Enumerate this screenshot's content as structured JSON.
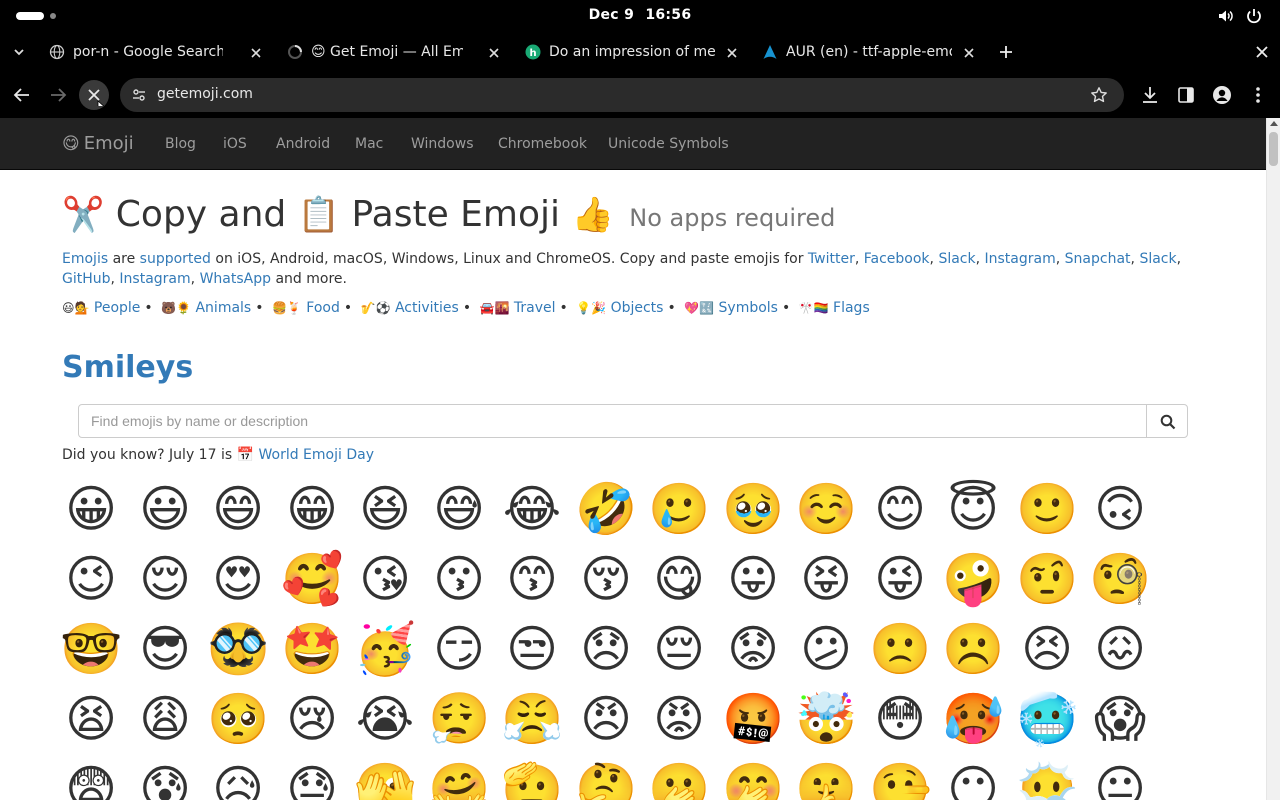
{
  "os": {
    "date": "Dec 9",
    "time": "16:56"
  },
  "tabs": [
    {
      "title": "por-n - Google Search",
      "favicon": "globe-icon"
    },
    {
      "title": "😊 Get Emoji — All Emoj",
      "favicon": "loading-spinner-icon"
    },
    {
      "title": "Do an impression of me",
      "favicon": "chatbot-icon"
    },
    {
      "title": "AUR (en) - ttf-apple-emo",
      "favicon": "arch-linux-icon"
    }
  ],
  "toolbar": {
    "url": "getemoji.com"
  },
  "site": {
    "brand_emoji": "😋",
    "brand": "Emoji",
    "nav": [
      "Blog",
      "iOS",
      "Android",
      "Mac",
      "Windows",
      "Chromebook",
      "Unicode Symbols"
    ],
    "headline": {
      "emoji1": "✂️",
      "text1": "Copy and",
      "emoji2": "📋",
      "text2": "Paste Emoji",
      "emoji3": "👍",
      "sub": "No apps required"
    },
    "intro": {
      "emojis": "Emojis",
      "are": "are",
      "supported": "supported",
      "text1": "on iOS, Android, macOS, Windows, Linux and ChromeOS. Copy and paste emojis for",
      "platforms": [
        "Twitter",
        "Facebook",
        "Slack",
        "Instagram",
        "Snapchat",
        "Slack",
        "GitHub",
        "Instagram",
        "WhatsApp"
      ],
      "text2": "and more."
    },
    "categories": [
      {
        "emojis": "😃💁",
        "label": "People"
      },
      {
        "emojis": "🐻🌻",
        "label": "Animals"
      },
      {
        "emojis": "🍔🍹",
        "label": "Food"
      },
      {
        "emojis": "🎷⚽️",
        "label": "Activities"
      },
      {
        "emojis": "🚘🌇",
        "label": "Travel"
      },
      {
        "emojis": "💡🎉",
        "label": "Objects"
      },
      {
        "emojis": "💖🔣",
        "label": "Symbols"
      },
      {
        "emojis": "🎌🏳️‍🌈",
        "label": "Flags"
      }
    ],
    "section_title": "Smileys",
    "search": {
      "placeholder": "Find emojis by name or description"
    },
    "did_you_know": {
      "text": "Did you know? July 17 is",
      "emoji": "📅",
      "link": "World Emoji Day"
    },
    "emoji_rows": [
      [
        "😀",
        "😃",
        "😄",
        "😁",
        "😆",
        "😅",
        "😂",
        "🤣",
        "🥲",
        "🥹",
        "☺️",
        "😊",
        "😇",
        "🙂",
        "🙃"
      ],
      [
        "😉",
        "😌",
        "😍",
        "🥰",
        "😘",
        "😗",
        "😙",
        "😚",
        "😋",
        "😛",
        "😝",
        "😜",
        "🤪",
        "🤨",
        "🧐"
      ],
      [
        "🤓",
        "😎",
        "🥸",
        "🤩",
        "🥳",
        "😏",
        "😒",
        "😞",
        "😔",
        "😟",
        "😕",
        "🙁",
        "☹️",
        "😣",
        "😖"
      ],
      [
        "😫",
        "😩",
        "🥺",
        "😢",
        "😭",
        "😮‍💨",
        "😤",
        "😠",
        "😡",
        "🤬",
        "🤯",
        "😳",
        "🥵",
        "🥶",
        "😱"
      ],
      [
        "😨",
        "😰",
        "😥",
        "😓",
        "🫣",
        "🤗",
        "🫡",
        "🤔",
        "🫢",
        "🤭",
        "🤫",
        "🤥",
        "😶",
        "😶‍🌫️",
        "😐"
      ]
    ]
  }
}
